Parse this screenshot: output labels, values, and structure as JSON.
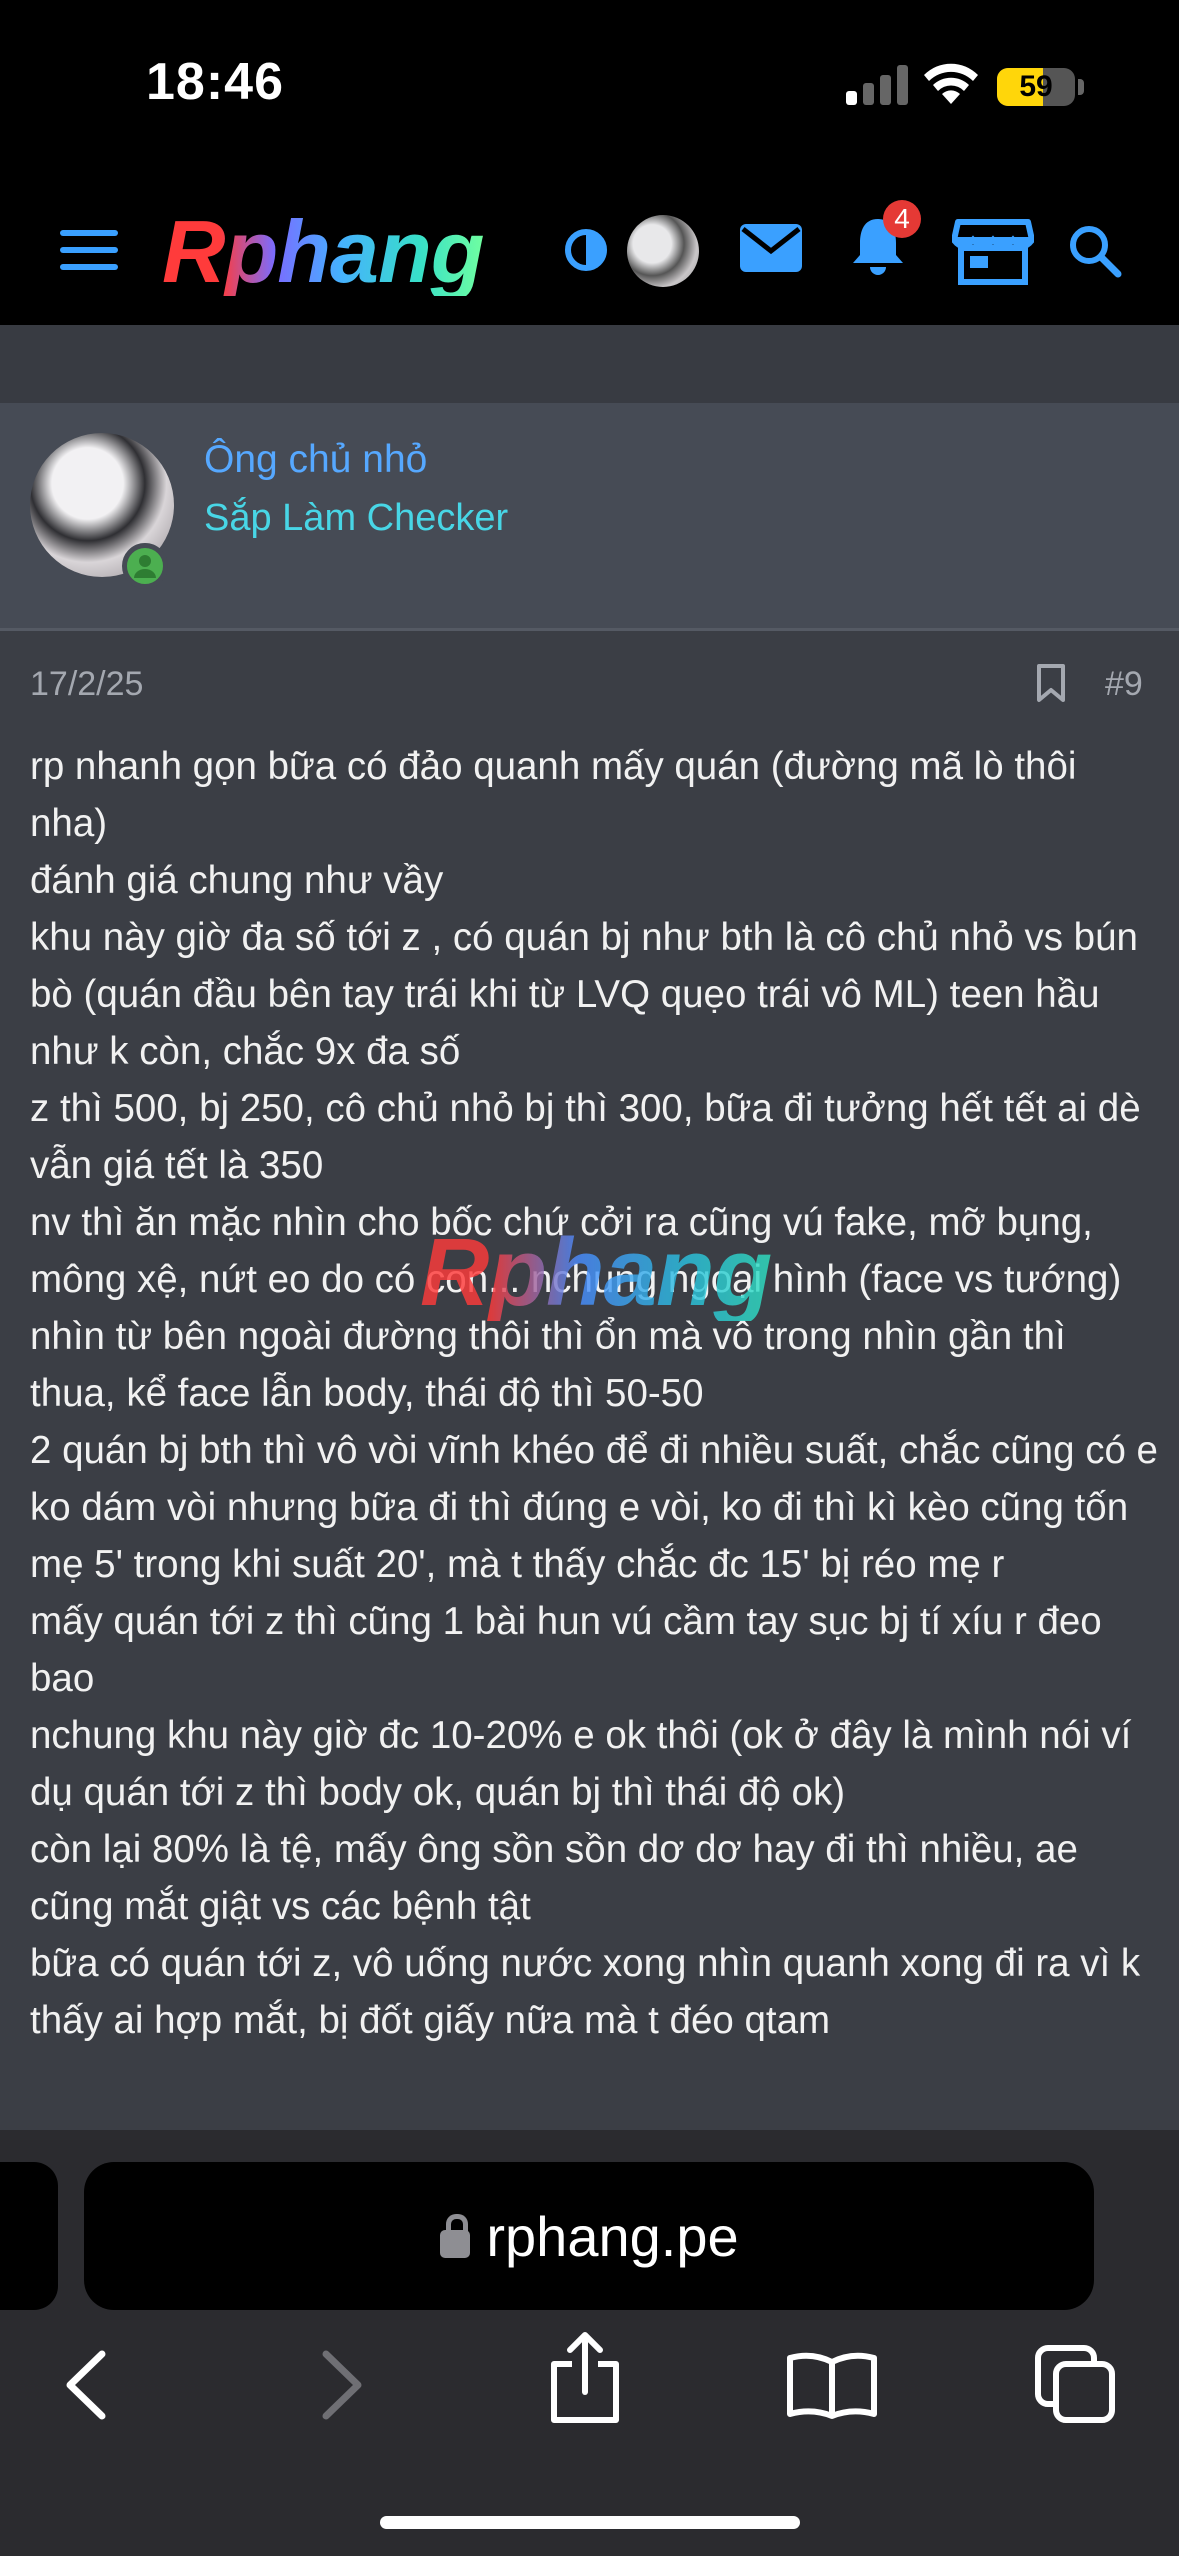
{
  "status_bar": {
    "time": "18:46",
    "battery": "59",
    "battery_level": 0.59
  },
  "header": {
    "logo": "Rphang",
    "notification_count": "4"
  },
  "user": {
    "name": "Ông chủ nhỏ",
    "title": "Sắp Làm Checker"
  },
  "post": {
    "date": "17/2/25",
    "number": "#9",
    "paragraphs": [
      "rp nhanh gọn bữa có đảo quanh mấy quán (đường mã lò thôi nha)",
      "đánh giá chung như vầy",
      "khu này giờ đa số tới z , có quán bj như bth là cô chủ nhỏ vs bún bò (quán đầu bên tay trái khi từ LVQ quẹo trái vô ML) teen hầu như k còn, chắc 9x đa số",
      "z thì 500, bj 250, cô chủ nhỏ bj thì 300, bữa đi tưởng hết tết ai dè vẫn giá tết là 350",
      "nv thì ăn mặc nhìn cho bốc chứ cởi ra cũng vú fake, mỡ bụng, mông xệ, nứt eo do có con... nchung ngoại hình (face vs tướng) nhìn từ bên ngoài đường thôi thì ổn mà vô trong nhìn gần thì thua, kể face lẫn body, thái độ thì 50-50",
      "2 quán bj bth thì vô vòi vĩnh khéo để đi nhiều suất, chắc cũng có e ko dám vòi nhưng bữa đi thì đúng e vòi, ko đi thì kì kèo cũng tốn mẹ 5' trong khi suất 20', mà t thấy chắc đc 15' bị réo mẹ r",
      "mấy quán tới z thì cũng 1 bài hun vú cầm tay sục bj tí xíu r đeo bao",
      "nchung khu này giờ đc 10-20% e ok thôi (ok ở đây là mình nói ví dụ quán tới z thì body ok, quán bj thì thái độ ok)",
      "còn lại 80% là tệ, mấy ông sồn sồn dơ dơ hay đi thì nhiều, ae cũng mắt giật vs các bệnh tật",
      "bữa có quán tới z, vô uống nước xong nhìn quanh xong đi ra vì k thấy ai hợp mắt, bị đốt giấy nữa mà t đéo qtam"
    ],
    "watermark": "Rphang"
  },
  "browser": {
    "url": "rphang.pe"
  },
  "colors": {
    "accent": "#3aa0ff",
    "username": "#56a8ff",
    "usertitle": "#48d6e6",
    "badge": "#e53935"
  }
}
